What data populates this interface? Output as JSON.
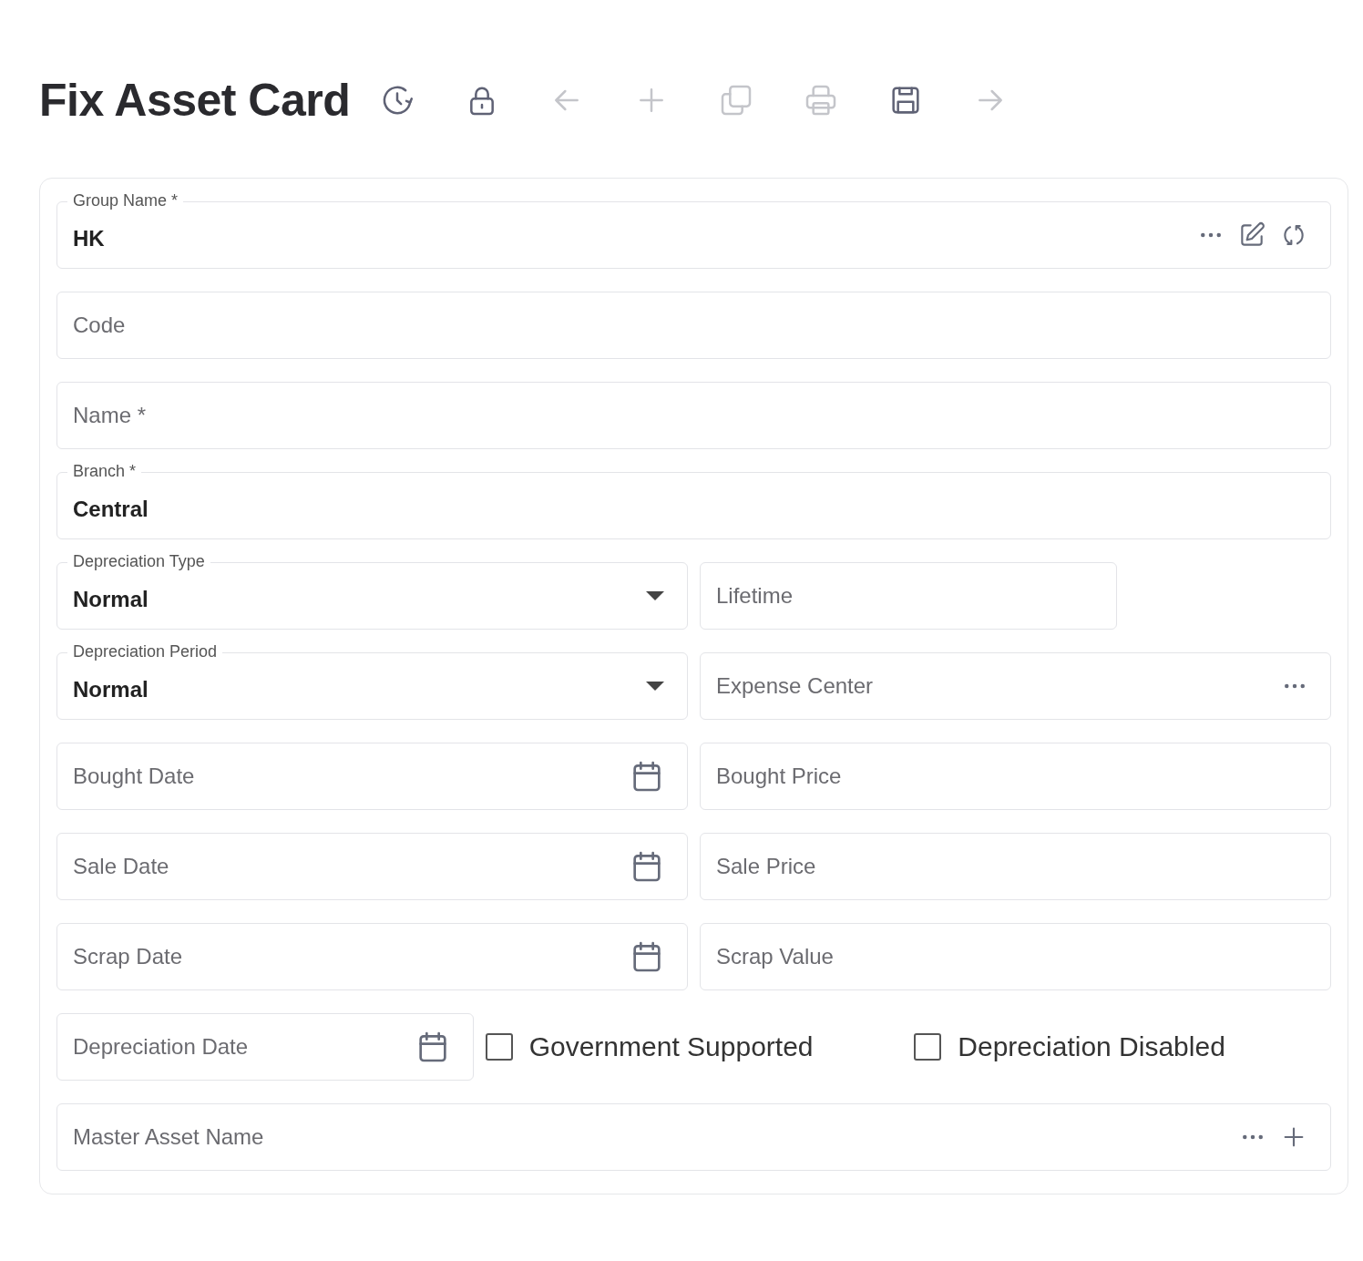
{
  "title": "Fix Asset Card",
  "toolbar": [
    {
      "kind": "history",
      "disabled": false
    },
    {
      "kind": "lock",
      "disabled": false
    },
    {
      "kind": "back",
      "disabled": true
    },
    {
      "kind": "add",
      "disabled": true
    },
    {
      "kind": "copy",
      "disabled": true
    },
    {
      "kind": "print",
      "disabled": true
    },
    {
      "kind": "save",
      "disabled": false
    },
    {
      "kind": "forward",
      "disabled": true
    }
  ],
  "rows": [
    {
      "kind": "full",
      "fields": [
        {
          "kind": "lookup",
          "label": "Group Name *",
          "value": "HK",
          "actions": [
            {
              "kind": "more"
            },
            {
              "kind": "edit"
            },
            {
              "kind": "refresh"
            }
          ]
        }
      ]
    },
    {
      "kind": "full",
      "fields": [
        {
          "kind": "text",
          "placeholder": "Code"
        }
      ]
    },
    {
      "kind": "full",
      "fields": [
        {
          "kind": "text",
          "placeholder": "Name *"
        }
      ]
    },
    {
      "kind": "full",
      "fields": [
        {
          "kind": "text",
          "label": "Branch *",
          "value": "Central"
        }
      ]
    },
    {
      "kind": "pair-short",
      "fields": [
        {
          "kind": "select",
          "label": "Depreciation Type",
          "value": "Normal"
        },
        {
          "kind": "text",
          "placeholder": "Lifetime"
        }
      ]
    },
    {
      "kind": "pair",
      "fields": [
        {
          "kind": "select",
          "label": "Depreciation Period",
          "value": "Normal"
        },
        {
          "kind": "lookup",
          "placeholder": "Expense Center",
          "actions": [
            {
              "kind": "more"
            }
          ]
        }
      ]
    },
    {
      "kind": "pair",
      "fields": [
        {
          "kind": "date",
          "placeholder": "Bought Date"
        },
        {
          "kind": "text",
          "placeholder": "Bought Price"
        }
      ]
    },
    {
      "kind": "pair",
      "fields": [
        {
          "kind": "date",
          "placeholder": "Sale Date"
        },
        {
          "kind": "text",
          "placeholder": "Sale Price"
        }
      ]
    },
    {
      "kind": "pair",
      "fields": [
        {
          "kind": "date",
          "placeholder": "Scrap Date"
        },
        {
          "kind": "text",
          "placeholder": "Scrap Value"
        }
      ]
    },
    {
      "kind": "checks",
      "fields": [
        {
          "kind": "date",
          "placeholder": "Depreciation Date"
        },
        {
          "kind": "checkbox",
          "label": "Government Supported",
          "checked": false
        },
        {
          "kind": "checkbox",
          "label": "Depreciation Disabled",
          "checked": false
        }
      ]
    },
    {
      "kind": "full",
      "fields": [
        {
          "kind": "lookup",
          "placeholder": "Master Asset Name",
          "actions": [
            {
              "kind": "more"
            },
            {
              "kind": "add"
            }
          ]
        }
      ]
    }
  ]
}
